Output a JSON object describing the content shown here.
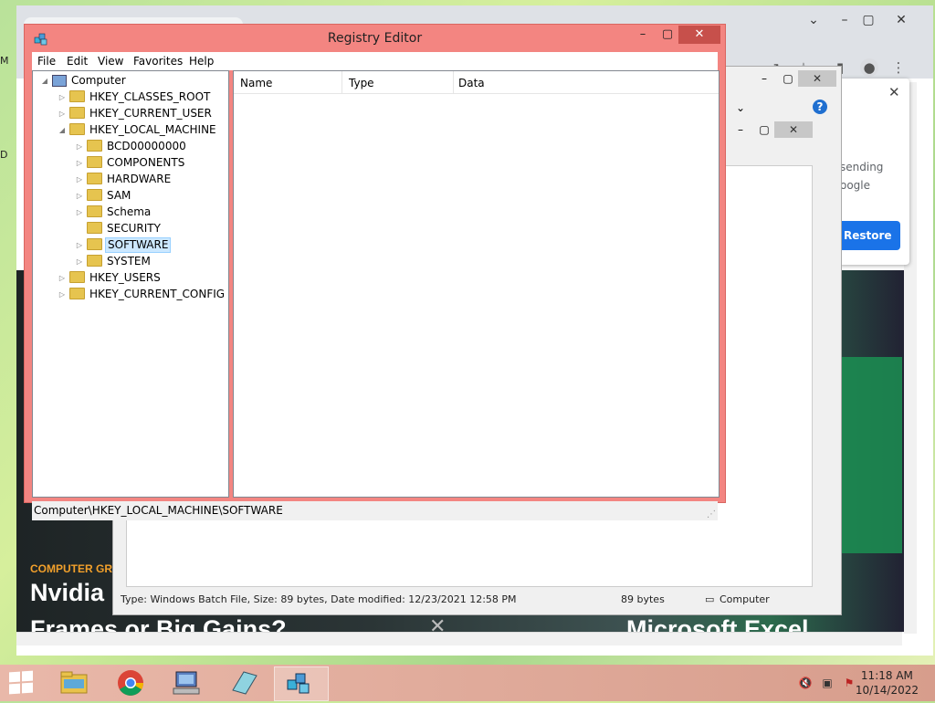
{
  "registry": {
    "title": "Registry Editor",
    "menu": [
      "File",
      "Edit",
      "View",
      "Favorites",
      "Help"
    ],
    "columns": [
      "Name",
      "Type",
      "Data"
    ],
    "tree": [
      {
        "label": "Computer",
        "level": 0,
        "expander": "expanded",
        "icon": "computer"
      },
      {
        "label": "HKEY_CLASSES_ROOT",
        "level": 1,
        "expander": "collapsed",
        "icon": "folder"
      },
      {
        "label": "HKEY_CURRENT_USER",
        "level": 1,
        "expander": "collapsed",
        "icon": "folder"
      },
      {
        "label": "HKEY_LOCAL_MACHINE",
        "level": 1,
        "expander": "expanded",
        "icon": "folder"
      },
      {
        "label": "BCD00000000",
        "level": 2,
        "expander": "collapsed",
        "icon": "folder"
      },
      {
        "label": "COMPONENTS",
        "level": 2,
        "expander": "collapsed",
        "icon": "folder"
      },
      {
        "label": "HARDWARE",
        "level": 2,
        "expander": "collapsed",
        "icon": "folder"
      },
      {
        "label": "SAM",
        "level": 2,
        "expander": "collapsed",
        "icon": "folder"
      },
      {
        "label": "Schema",
        "level": 2,
        "expander": "collapsed",
        "icon": "folder"
      },
      {
        "label": "SECURITY",
        "level": 2,
        "expander": "none",
        "icon": "folder"
      },
      {
        "label": "SOFTWARE",
        "level": 2,
        "expander": "collapsed",
        "icon": "folder",
        "selected": true
      },
      {
        "label": "SYSTEM",
        "level": 2,
        "expander": "collapsed",
        "icon": "folder"
      },
      {
        "label": "HKEY_USERS",
        "level": 1,
        "expander": "collapsed",
        "icon": "folder"
      },
      {
        "label": "HKEY_CURRENT_CONFIG",
        "level": 1,
        "expander": "collapsed",
        "icon": "folder"
      }
    ],
    "status_path": "Computer\\HKEY_LOCAL_MACHINE\\SOFTWARE",
    "accent": "#f38581"
  },
  "explorer": {
    "status_left": "Type: Windows Batch File, Size: 89 bytes, Date modified: 12/23/2021 12:58 PM",
    "status_size": "89 bytes",
    "status_location": "Computer"
  },
  "browser": {
    "popup": {
      "text1": "sending",
      "text2": "oogle",
      "button": "Restore"
    },
    "hero": {
      "category": "COMPUTER GRA",
      "headline1": "Nvidia I",
      "headline2": "Frames or Big Gains?",
      "headline3": "Microsoft Excel"
    }
  },
  "taskbar": {
    "time": "11:18 AM",
    "date": "10/14/2022",
    "apps": [
      "file-explorer",
      "chrome",
      "remote-desktop",
      "notepad",
      "registry-editor"
    ]
  }
}
